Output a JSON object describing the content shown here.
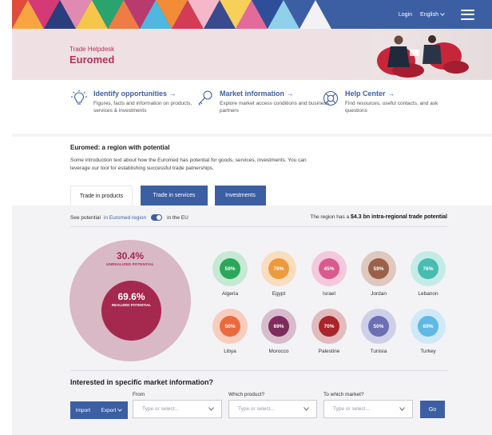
{
  "header": {
    "login": "Login",
    "language": "English"
  },
  "hero": {
    "subtitle": "Trade Helpdesk",
    "title": "Euromed"
  },
  "features": [
    {
      "title": "Identify opportunities →",
      "desc": "Figures, facts and information on products, services & investments",
      "icon": "lightbulb-icon"
    },
    {
      "title": "Market information →",
      "desc": "Explore market access conditions and business partners",
      "icon": "key-icon"
    },
    {
      "title": "Help Center →",
      "desc": "Find resources, useful contacts, and ask questions",
      "icon": "lifebuoy-icon"
    }
  ],
  "intro": {
    "title": "Euromed: a region with potential",
    "text": "Some introduction text about how the Euromed has potential for goods, services, investments. You can leverage our tool for establishing successful trade patnerships."
  },
  "tabs": [
    "Trade in products",
    "Trade in services",
    "Investments"
  ],
  "potential": {
    "see": "See potential",
    "in_region": "in Euromed region",
    "in_eu": "in the EU",
    "note_prefix": "The region has a",
    "note_value": "$4.3 bn intra-regional trade potential"
  },
  "donut": {
    "unrealized_pct": "30.4%",
    "unrealized_label": "UNREALIZED POTENTIAL",
    "realized_pct": "69.6%",
    "realized_label": "REALIZED POTENTIAL"
  },
  "countries": [
    {
      "name": "Algeria",
      "pct": "59%",
      "color": "#2aa85a",
      "ring": "#c6e9d3"
    },
    {
      "name": "Egypt",
      "pct": "76%",
      "color": "#ee9a3c",
      "ring": "#f8ddbf"
    },
    {
      "name": "Israel",
      "pct": "45%",
      "color": "#d95a8e",
      "ring": "#f3c9db"
    },
    {
      "name": "Jordan",
      "pct": "59%",
      "color": "#9a6148",
      "ring": "#dfc8bd"
    },
    {
      "name": "Lebanon",
      "pct": "76%",
      "color": "#46bdb0",
      "ring": "#c5ebe6"
    },
    {
      "name": "Libya",
      "pct": "50%",
      "color": "#ea6a3e",
      "ring": "#f8cdbd"
    },
    {
      "name": "Morocco",
      "pct": "69%",
      "color": "#7e2c5d",
      "ring": "#d8bccc"
    },
    {
      "name": "Palestine",
      "pct": "70%",
      "color": "#a9252b",
      "ring": "#e2bcbd"
    },
    {
      "name": "Tunisia",
      "pct": "50%",
      "color": "#6c6fb3",
      "ring": "#cfd0e8"
    },
    {
      "name": "Turkey",
      "pct": "69%",
      "color": "#5fb9e5",
      "ring": "#cfe9f6"
    }
  ],
  "form": {
    "question": "Interested in specific market information?",
    "import": "Import",
    "export": "Export",
    "from_label": "From",
    "product_label": "Which product?",
    "market_label": "To which market?",
    "placeholder": "Type or select...",
    "go": "Go"
  }
}
